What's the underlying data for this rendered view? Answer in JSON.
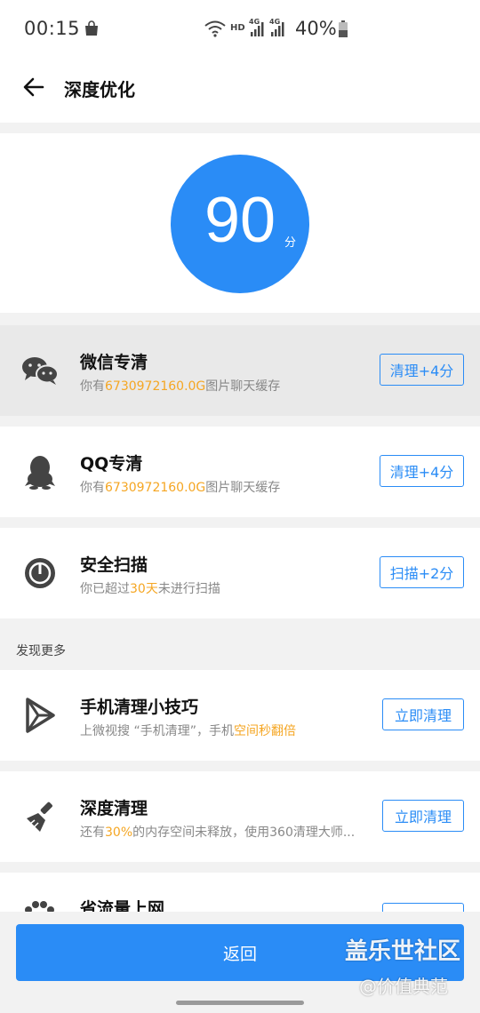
{
  "status_bar": {
    "time": "00:15",
    "hd": "HD",
    "lte1": "4G",
    "lte2": "4G",
    "battery": "40%"
  },
  "header": {
    "title": "深度优化"
  },
  "score": {
    "value": "90",
    "unit": "分"
  },
  "cards": [
    {
      "title": "微信专清",
      "sub_prefix": "你有",
      "sub_highlight": "6730972160.0G",
      "sub_suffix": "图片聊天缓存",
      "button": "清理+4分",
      "icon": "wechat-icon"
    },
    {
      "title": "QQ专清",
      "sub_prefix": "你有",
      "sub_highlight": "6730972160.0G",
      "sub_suffix": "图片聊天缓存",
      "button": "清理+4分",
      "icon": "qq-icon"
    },
    {
      "title": "安全扫描",
      "sub_prefix": "你已超过",
      "sub_highlight": "30天",
      "sub_suffix": "未进行扫描",
      "button": "扫描+2分",
      "icon": "scan-icon"
    }
  ],
  "section": {
    "discover_more": "发现更多"
  },
  "discover": [
    {
      "title": "手机清理小技巧",
      "sub_prefix": "上微视搜 “手机清理”，手机",
      "sub_highlight": "空间秒翻倍",
      "sub_suffix": "",
      "button": "立即清理",
      "icon": "play-icon"
    },
    {
      "title": "深度清理",
      "sub_prefix": "还有",
      "sub_highlight": "30%",
      "sub_suffix": "的内存空间未释放，使用360清理大师...",
      "button": "立即清理",
      "icon": "broom-icon"
    },
    {
      "title": "省流量上网",
      "button": "",
      "icon": "paw-icon"
    }
  ],
  "bottom": {
    "button": "返回"
  },
  "watermark": {
    "line1": "盖乐世社区",
    "line2": "@价值典范"
  },
  "colors": {
    "accent": "#2a8cf6",
    "highlight": "#f5a623"
  }
}
